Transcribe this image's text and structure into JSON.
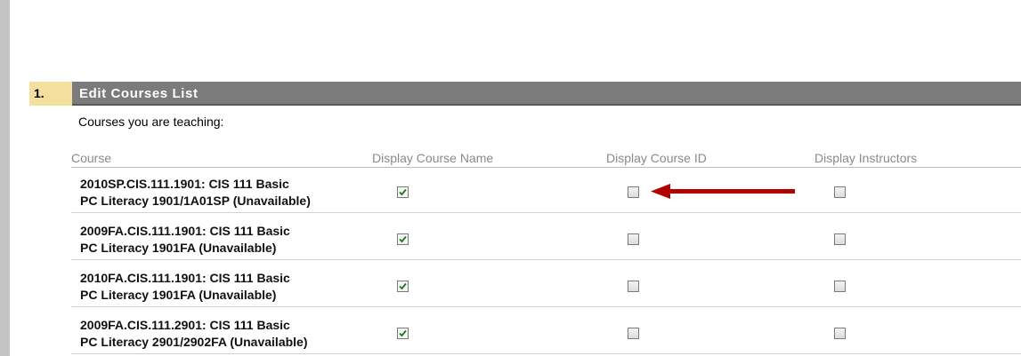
{
  "step": {
    "number": "1.",
    "title": "Edit Courses List"
  },
  "caption": "Courses you are teaching:",
  "columns": {
    "course": "Course",
    "display_course_name": "Display Course Name",
    "display_course_id": "Display Course ID",
    "display_instructors": "Display Instructors"
  },
  "rows": [
    {
      "line1": "2010SP.CIS.111.1901: CIS 111 Basic",
      "line2": "PC Literacy 1901/1A01SP (Unavailable)",
      "display_course_name": true,
      "display_course_id": false,
      "display_instructors": false
    },
    {
      "line1": "2009FA.CIS.111.1901: CIS 111 Basic",
      "line2": "PC Literacy 1901FA (Unavailable)",
      "display_course_name": true,
      "display_course_id": false,
      "display_instructors": false
    },
    {
      "line1": "2010FA.CIS.111.1901: CIS 111 Basic",
      "line2": "PC Literacy 1901FA (Unavailable)",
      "display_course_name": true,
      "display_course_id": false,
      "display_instructors": false
    },
    {
      "line1": "2009FA.CIS.111.2901: CIS 111 Basic",
      "line2": "PC Literacy 2901/2902FA (Unavailable)",
      "display_course_name": true,
      "display_course_id": false,
      "display_instructors": false
    }
  ],
  "colors": {
    "header_bar": "#7b7b7b",
    "step_badge": "#f5df9e",
    "arrow": "#b30000",
    "check": "#1a7a1a"
  },
  "annotation_icon": "red-arrow-icon"
}
